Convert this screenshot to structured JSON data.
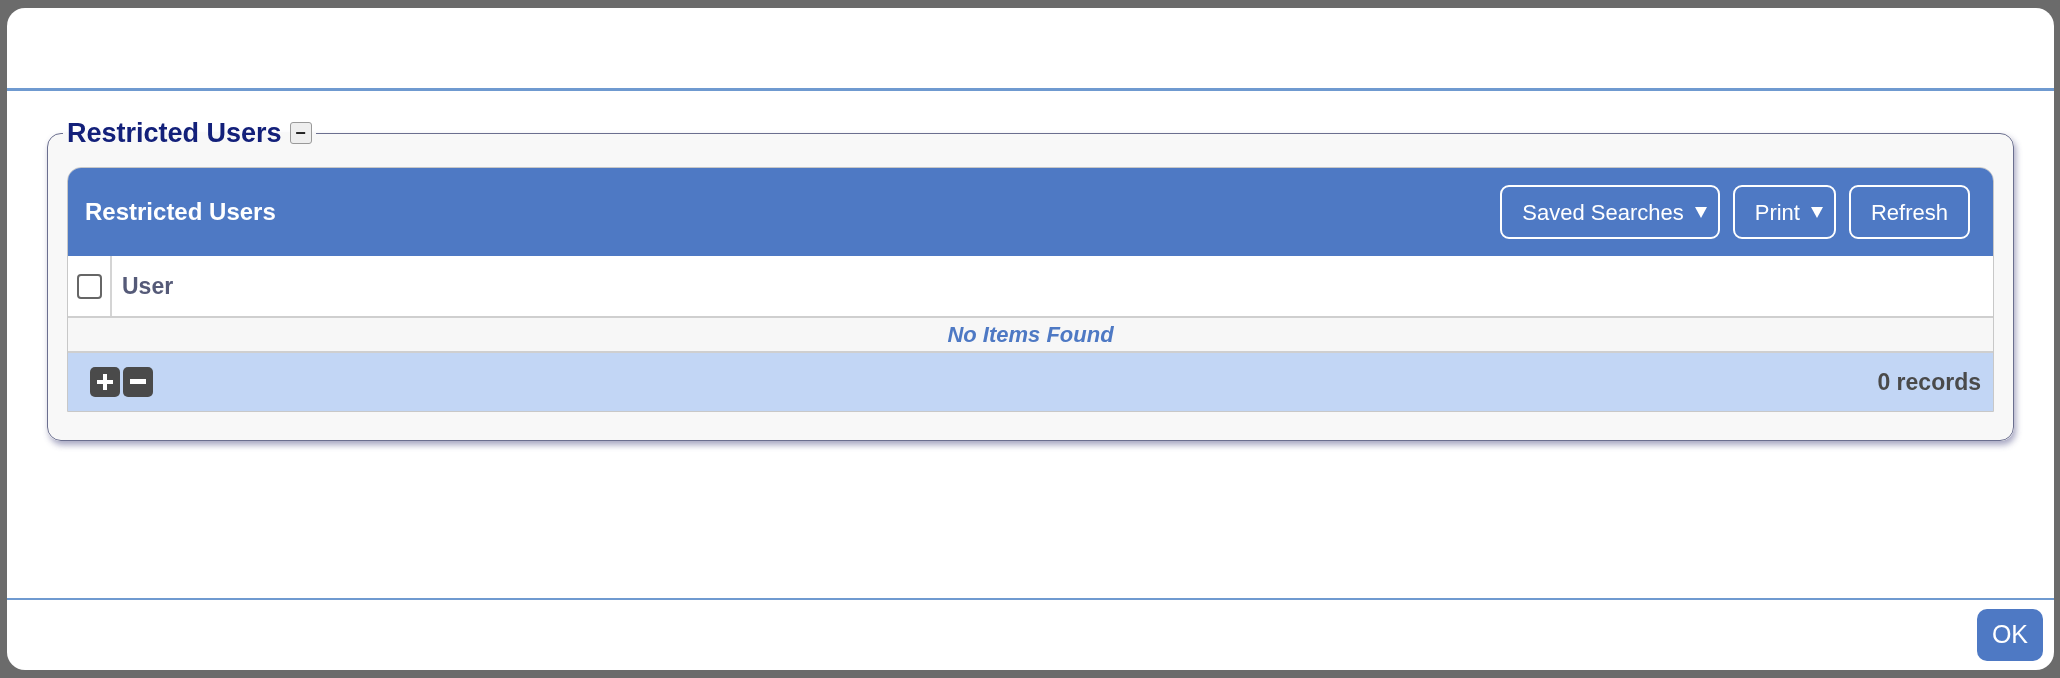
{
  "section": {
    "legend": "Restricted Users",
    "collapse_icon": "−"
  },
  "grid": {
    "title": "Restricted Users",
    "toolbar": [
      {
        "label": "Saved Searches",
        "dropdown": true
      },
      {
        "label": "Print",
        "dropdown": true
      },
      {
        "label": "Refresh",
        "dropdown": false
      }
    ],
    "select_all": {
      "checked": false
    },
    "columns": [
      "User"
    ],
    "empty_message": "No Items Found",
    "record_count": "0 records"
  },
  "footer": {
    "buttons": [
      "OK"
    ]
  }
}
